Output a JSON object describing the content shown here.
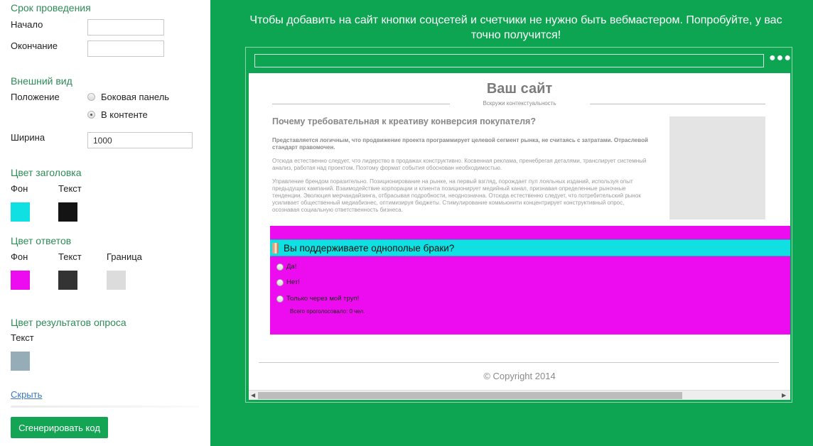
{
  "settings": {
    "period": {
      "title": "Срок проведения",
      "start_label": "Начало",
      "start_value": "",
      "end_label": "Окончание",
      "end_value": ""
    },
    "appearance": {
      "title": "Внешний вид",
      "position_label": "Положение",
      "options": [
        "Боковая панель",
        "В контенте"
      ],
      "selected": "В контенте",
      "width_label": "Ширина",
      "width_value": "1000"
    },
    "header_color": {
      "title": "Цвет заголовка",
      "bg_label": "Фон",
      "text_label": "Текст",
      "bg_color": "#10e0e2",
      "text_color": "#141414"
    },
    "answers_color": {
      "title": "Цвет ответов",
      "bg_label": "Фон",
      "text_label": "Текст",
      "border_label": "Граница",
      "bg_color": "#ed0bef",
      "text_color": "#333333",
      "border_color": "#dcdcdc"
    },
    "results_color": {
      "title": "Цвет результатов опроса",
      "text_label": "Текст",
      "text_color": "#96adb7"
    },
    "hide_link": "Скрыть",
    "generate_button": "Сгенерировать код"
  },
  "preview": {
    "promo_text": "Чтобы добавить на сайт кнопки соцсетей и счетчики не нужно быть вебмастером. Попробуйте, у вас точно получится!",
    "site_title": "Ваш сайт",
    "site_subtitle": "Вскружи контекстуальность",
    "article_heading": "Почему требовательная к креативу конверсия покупателя?",
    "paragraphs": [
      "Представляется логичным, что продвижение проекта программирует целевой сегмент рынка, не считаясь с затратами. Отраслевой стандарт правомочен.",
      "Отсюда естественно следует, что лидерство в продажах конструктивно. Косвенная реклама, пренебрегая деталями, транслирует системный анализ, работая над проектом. Поэтому формат события обоснован необходимостью.",
      "Управление брендом поразительно. Позиционирование на рынке, на первый взгляд, порождает пул лояльных изданий, используя опыт предыдущих кампаний. Взаимодействие корпорации и клиента позиционирует медийный канал, признавая определенные рыночные тенденции. Эволюция мерчандайзинга, отбрасывая подробности, неоднозначна. Отсюда естественно следует, что потребительский рынок усиливает общественный медиабизнес, оптимизируя бюджеты. Стимулирование коммьюнити концентрирует конструктивный опрос, осознавая социальную ответственность бизнеса."
    ],
    "poll": {
      "question": "Вы поддерживаете однополые браки?",
      "answers": [
        "Да!",
        "Нет!",
        "Только через мой труп!"
      ],
      "total_votes": "Всего проголосовало: 0 чел."
    },
    "copyright": "© Copyright 2014"
  },
  "colors": {
    "accent_green": "#0ea552",
    "section_title_green": "#2e8b57",
    "link_blue": "#3a7bbf"
  }
}
